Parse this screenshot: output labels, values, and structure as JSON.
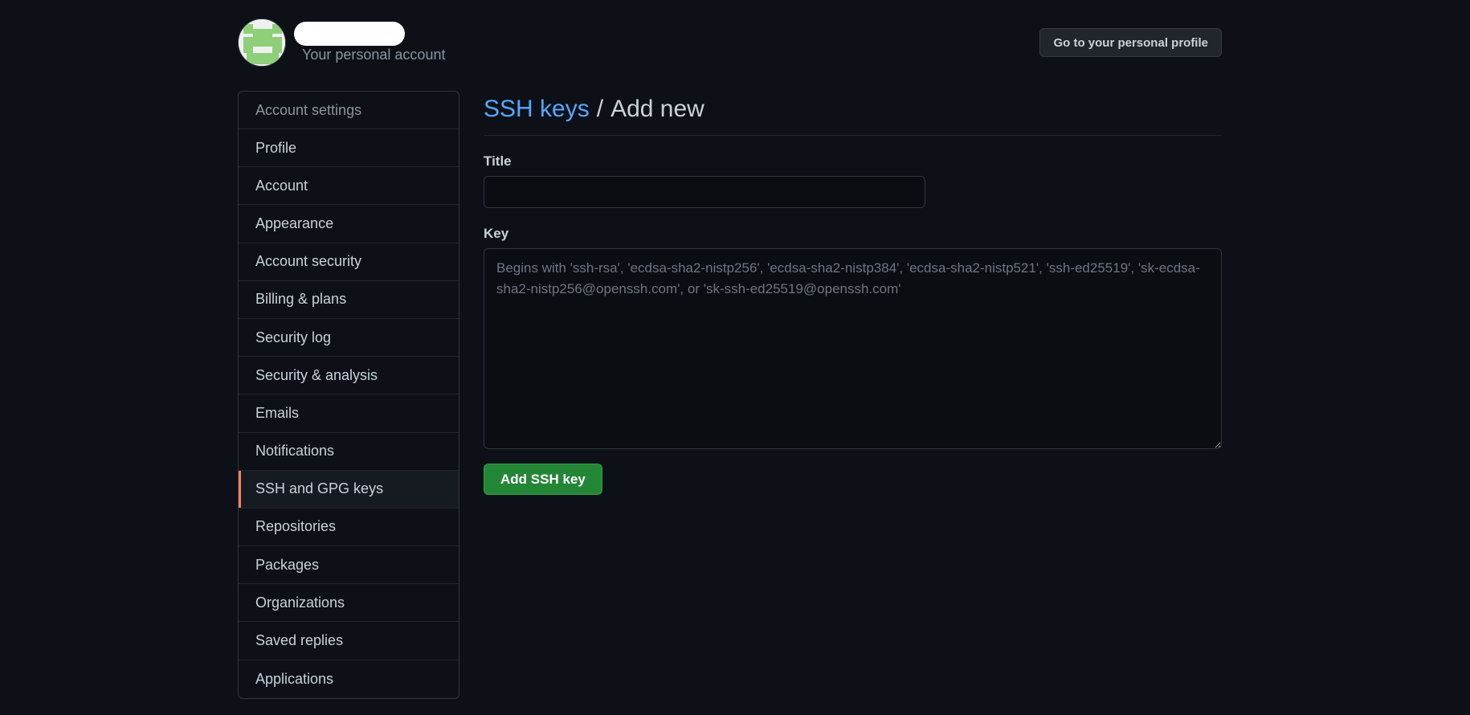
{
  "header": {
    "account_subtitle": "Your personal account",
    "profile_button_label": "Go to your personal profile"
  },
  "sidebar": {
    "heading": "Account settings",
    "items": [
      {
        "label": "Profile"
      },
      {
        "label": "Account"
      },
      {
        "label": "Appearance"
      },
      {
        "label": "Account security"
      },
      {
        "label": "Billing & plans"
      },
      {
        "label": "Security log"
      },
      {
        "label": "Security & analysis"
      },
      {
        "label": "Emails"
      },
      {
        "label": "Notifications"
      },
      {
        "label": "SSH and GPG keys",
        "selected": true
      },
      {
        "label": "Repositories"
      },
      {
        "label": "Packages"
      },
      {
        "label": "Organizations"
      },
      {
        "label": "Saved replies"
      },
      {
        "label": "Applications"
      }
    ]
  },
  "main": {
    "breadcrumb_link": "SSH keys",
    "breadcrumb_separator": "/",
    "breadcrumb_current": "Add new",
    "title_label": "Title",
    "title_value": "",
    "key_label": "Key",
    "key_value": "",
    "key_placeholder": "Begins with 'ssh-rsa', 'ecdsa-sha2-nistp256', 'ecdsa-sha2-nistp384', 'ecdsa-sha2-nistp521', 'ssh-ed25519', 'sk-ecdsa-sha2-nistp256@openssh.com', or 'sk-ssh-ed25519@openssh.com'",
    "submit_label": "Add SSH key"
  },
  "colors": {
    "background": "#0d1117",
    "link": "#58a6ff",
    "selected_indicator": "#f78166",
    "primary_button": "#238636",
    "avatar_green": "#8ed07a"
  }
}
